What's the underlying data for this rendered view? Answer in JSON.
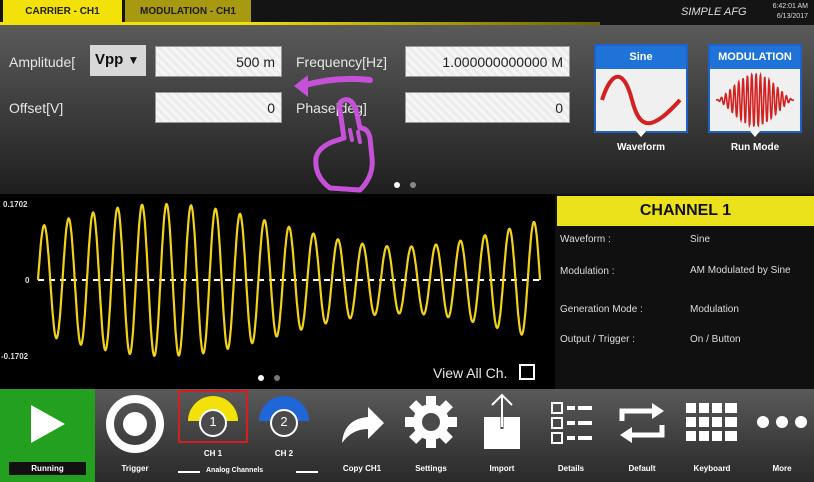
{
  "tabs": [
    {
      "label": "CARRIER - CH1"
    },
    {
      "label": "MODULATION - CH1"
    }
  ],
  "app": {
    "brand": "SIMPLE AFG",
    "time": "6:42:01 AM",
    "date": "6/13/2017"
  },
  "controls": {
    "amplitude_label": "Amplitude[",
    "amplitude_unit": "Vpp",
    "amplitude_value": "500 m",
    "offset_label": "Offset[V]",
    "offset_value": "0",
    "frequency_label": "Frequency[Hz]",
    "frequency_value": "1.000000000000 M",
    "phase_label": "Phase[deg]",
    "phase_value": "0"
  },
  "cards": {
    "waveform": {
      "head": "Sine",
      "caption": "Waveform"
    },
    "runmode": {
      "head": "MODULATION",
      "caption": "Run Mode"
    }
  },
  "graph": {
    "y_max_label": "0.1702",
    "y_zero_label": "0",
    "y_min_label": "-0.1702",
    "view_all_label": "View All Ch.",
    "view_all_checked": false,
    "trace_color": "#f1d21a"
  },
  "info": {
    "title": "CHANNEL 1",
    "rows": [
      {
        "key": "Waveform :",
        "value": "Sine"
      },
      {
        "key": "Modulation :",
        "value": "AM Modulated by Sine"
      },
      {
        "key": "Generation Mode :",
        "value": "Modulation"
      },
      {
        "key": "Output / Trigger :",
        "value": "On / Button"
      }
    ]
  },
  "toolbar": {
    "running": "Running",
    "trigger": "Trigger",
    "ch1": "CH 1",
    "ch1_num": "1",
    "ch2": "CH 2",
    "ch2_num": "2",
    "analog_channels": "Analog Channels",
    "copy": "Copy CH1",
    "settings": "Settings",
    "import": "Import",
    "details": "Details",
    "default": "Default",
    "keyboard": "Keyboard",
    "more": "More"
  },
  "colors": {
    "accent_yellow": "#f2e20a",
    "card_blue": "#1f72d8",
    "running_green": "#24a021",
    "waveform_red": "#d42020"
  }
}
